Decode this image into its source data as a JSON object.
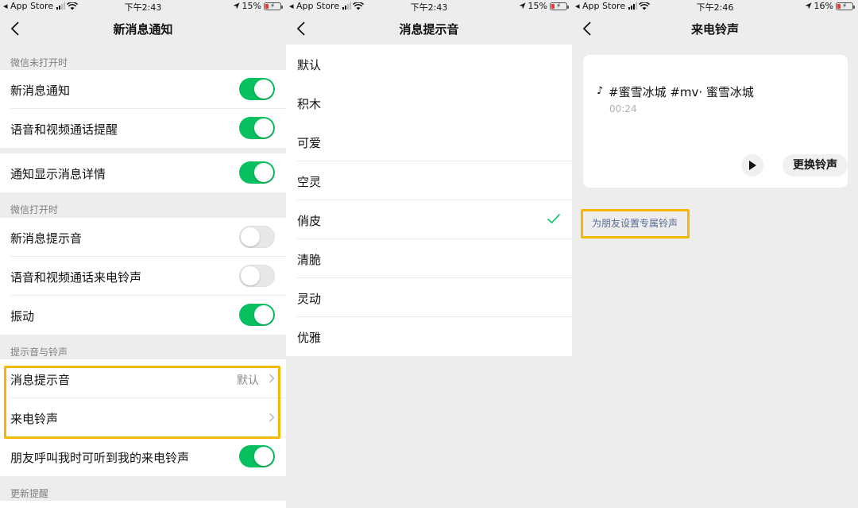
{
  "panels": [
    {
      "status": {
        "carrier": "App Store",
        "time": "下午2:43",
        "battery": "15%"
      },
      "title": "新消息通知",
      "sections": [
        {
          "header": "微信未打开时",
          "groups": [
            [
              {
                "label": "新消息通知",
                "toggle": "on"
              },
              {
                "label": "语音和视频通话提醒",
                "toggle": "on"
              }
            ],
            [
              {
                "label": "通知显示消息详情",
                "toggle": "on"
              }
            ]
          ]
        },
        {
          "header": "微信打开时",
          "groups": [
            [
              {
                "label": "新消息提示音",
                "toggle": "off"
              },
              {
                "label": "语音和视频通话来电铃声",
                "toggle": "off"
              },
              {
                "label": "振动",
                "toggle": "on"
              }
            ]
          ]
        },
        {
          "header": "提示音与铃声",
          "groups": [
            [
              {
                "label": "消息提示音",
                "value": "默认"
              },
              {
                "label": "来电铃声",
                "value": ""
              },
              {
                "label": "朋友呼叫我时可听到我的来电铃声",
                "toggle": "on"
              }
            ]
          ]
        },
        {
          "header": "更新提醒",
          "groups": []
        }
      ]
    },
    {
      "status": {
        "carrier": "App Store",
        "time": "下午2:43",
        "battery": "15%"
      },
      "title": "消息提示音",
      "items": [
        "默认",
        "积木",
        "可爱",
        "空灵",
        "俏皮",
        "清脆",
        "灵动",
        "优雅"
      ],
      "selected_index": 4
    },
    {
      "status": {
        "carrier": "App Store",
        "time": "下午2:46",
        "battery": "16%"
      },
      "title": "来电铃声",
      "ringtone": {
        "name": "#蜜雪冰城 #mv· 蜜雪冰城",
        "duration": "00:24"
      },
      "change_label": "更换铃声",
      "friend_link": "为朋友设置专属铃声"
    }
  ],
  "colors": {
    "toggle_on": "#07c160",
    "highlight": "#f5b800",
    "link": "#576b95"
  },
  "icons": [
    "back-chevron-icon",
    "wifi-icon",
    "location-arrow-icon",
    "battery-icon",
    "chevron-right-icon",
    "check-icon",
    "music-note-icon",
    "play-icon"
  ]
}
